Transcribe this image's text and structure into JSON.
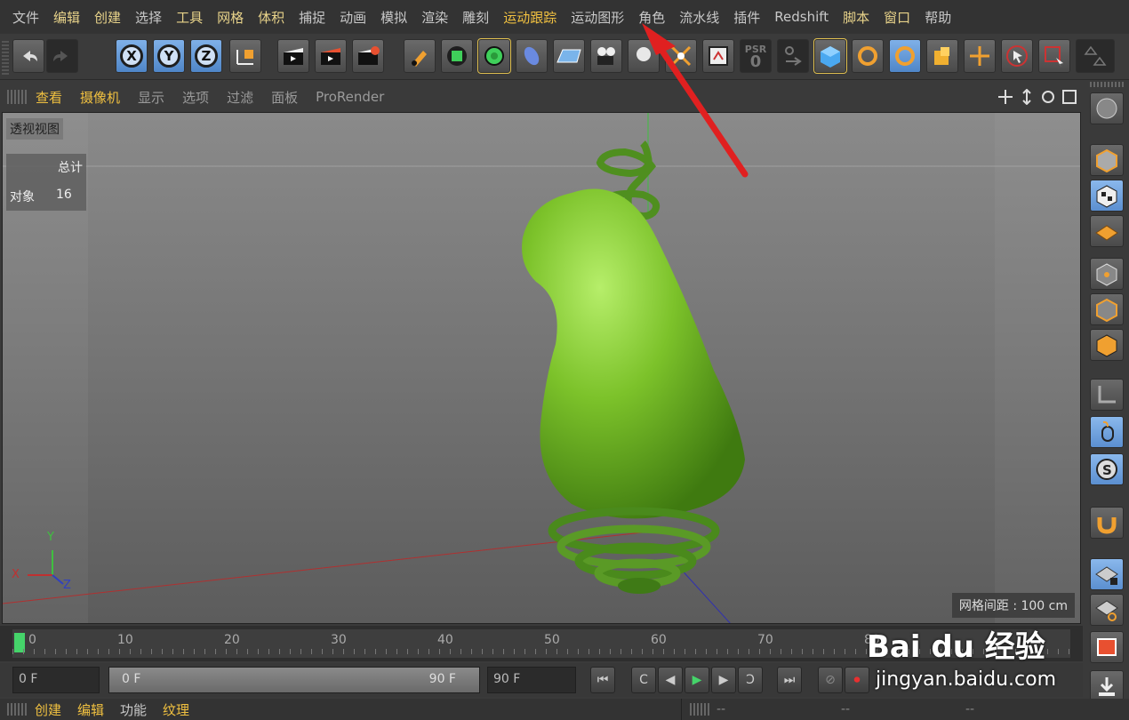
{
  "menubar": {
    "items": [
      "文件",
      "编辑",
      "创建",
      "选择",
      "工具",
      "网格",
      "体积",
      "捕捉",
      "动画",
      "模拟",
      "渲染",
      "雕刻",
      "运动跟踪",
      "运动图形",
      "角色",
      "流水线",
      "插件",
      "Redshift",
      "脚本",
      "窗口",
      "帮助"
    ]
  },
  "viewmenu": {
    "items": [
      "查看",
      "摄像机",
      "显示",
      "选项",
      "过滤",
      "面板",
      "ProRender"
    ]
  },
  "viewport": {
    "label": "透视视图",
    "stats_header": "总计",
    "stats_key": "对象",
    "stats_value": "16",
    "grid_spacing": "网格间距 : 100 cm",
    "object_color": "#7cc22a",
    "axis_labels": {
      "y": "Y",
      "x": "X",
      "z": "Z"
    }
  },
  "toolbar": {
    "axis_buttons": [
      "X",
      "Y",
      "Z"
    ],
    "psr_label": "PSR",
    "psr_value": "0"
  },
  "timeline": {
    "ticks": [
      "0",
      "10",
      "20",
      "30",
      "40",
      "50",
      "60",
      "70",
      "80"
    ]
  },
  "transport": {
    "current_frame": "0 F",
    "range_start": "0 F",
    "range_end": "90 F",
    "max_frame": "90 F"
  },
  "bottom_menu": {
    "items": [
      "创建",
      "编辑",
      "功能",
      "纹理"
    ],
    "right_items": [
      "--",
      "--",
      "--",
      "--"
    ]
  },
  "watermark": {
    "brand": "Bai du 经验",
    "url": "jingyan.baidu.com"
  }
}
